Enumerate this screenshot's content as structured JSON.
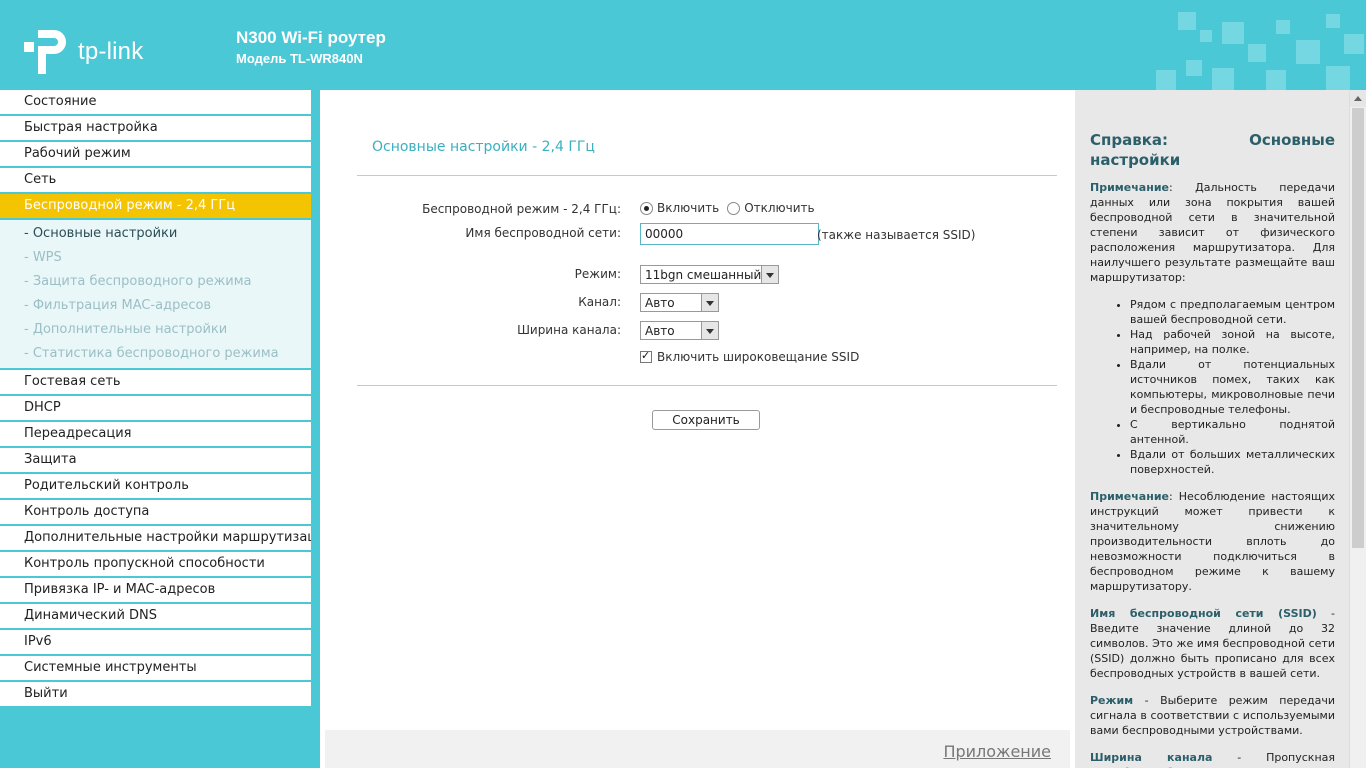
{
  "header": {
    "logo_text": "tp-link",
    "title": "N300 Wi-Fi роутер",
    "model": "Модель TL-WR840N"
  },
  "sidebar": {
    "items": [
      {
        "label": "Состояние"
      },
      {
        "label": "Быстрая настройка"
      },
      {
        "label": "Рабочий режим"
      },
      {
        "label": "Сеть"
      },
      {
        "label": "Беспроводной режим - 2,4 ГГц",
        "active": true
      }
    ],
    "submenu": [
      {
        "label": "- Основные настройки",
        "current": true
      },
      {
        "label": "- WPS"
      },
      {
        "label": "- Защита беспроводного режима"
      },
      {
        "label": "- Фильтрация MAC-адресов"
      },
      {
        "label": "- Дополнительные настройки"
      },
      {
        "label": "- Статистика беспроводного режима"
      }
    ],
    "items_after": [
      {
        "label": "Гостевая сеть"
      },
      {
        "label": "DHCP"
      },
      {
        "label": "Переадресация"
      },
      {
        "label": "Защита"
      },
      {
        "label": "Родительский контроль"
      },
      {
        "label": "Контроль доступа"
      },
      {
        "label": "Дополнительные настройки маршрутизации"
      },
      {
        "label": "Контроль пропускной способности"
      },
      {
        "label": "Привязка IP- и MAC-адресов"
      },
      {
        "label": "Динамический DNS"
      },
      {
        "label": "IPv6"
      },
      {
        "label": "Системные инструменты"
      },
      {
        "label": "Выйти"
      }
    ],
    "active_color": "#f5c400"
  },
  "main": {
    "section_title": "Основные настройки - 2,4 ГГц",
    "wireless_mode": {
      "label": "Беспроводной режим - 2,4 ГГц:",
      "option_on": "Включить",
      "option_off": "Отключить",
      "selected": "on"
    },
    "ssid": {
      "label": "Имя беспроводной сети:",
      "value": "00000",
      "hint": "(также называется SSID)"
    },
    "mode": {
      "label": "Режим:",
      "value": "11bgn смешанный"
    },
    "channel": {
      "label": "Канал:",
      "value": "Авто"
    },
    "channel_width": {
      "label": "Ширина канала:",
      "value": "Авто"
    },
    "ssid_broadcast": {
      "label": "Включить широковещание SSID",
      "checked": true
    },
    "save_label": "Сохранить",
    "appendix_label": "Приложение"
  },
  "help": {
    "title_left": "Справка:",
    "title_right": "Основные",
    "title_line2": "настройки",
    "note1_label": "Примечание",
    "note1_text": ": Дальность передачи данных или зона покрытия вашей беспроводной сети в значительной степени зависит от физического расположения маршрутизатора. Для наилучшего результате размещайте ваш маршрутизатор:",
    "bullets": [
      "Рядом с предполагаемым центром вашей беспроводной сети.",
      "Над рабочей зоной на высоте, например, на полке.",
      "Вдали от потенциальных источников помех, таких как компьютеры, микроволновые печи и беспроводные телефоны.",
      "С вертикально поднятой антенной.",
      "Вдали от больших металлических поверхностей."
    ],
    "note2_label": "Примечание",
    "note2_text": ": Несоблюдение настоящих инструкций может привести к значительному снижению производительности вплоть до невозможности подключиться в беспроводном режиме к вашему маршрутизатору.",
    "ssid_label": "Имя беспроводной сети (SSID)",
    "ssid_text": " - Введите значение длиной до 32 символов. Это же имя беспроводной сети (SSID) должно быть прописано для всех беспроводных устройств в вашей сети.",
    "mode_label": "Режим",
    "mode_text": " - Выберите режим передачи сигнала в соответствии с используемыми вами беспроводными устройствами.",
    "width_label": "Ширина канала",
    "width_text": " - Пропускная способность беспроводного канала."
  }
}
